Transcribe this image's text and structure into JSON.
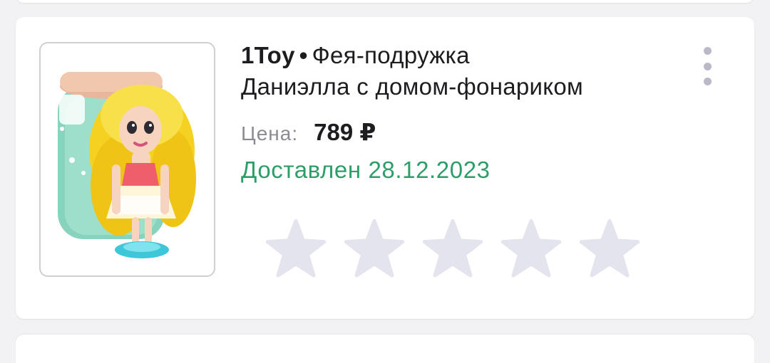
{
  "order": {
    "brand": "1Toy",
    "separator": "•",
    "product_line1": "Фея-подружка",
    "product_line2": "Даниэлла с домом-фонариком",
    "price_label": "Цена:",
    "price_value": "789 ₽",
    "status": "Доставлен 28.12.2023",
    "rating": {
      "max_stars": 5,
      "selected_stars": 0
    },
    "product_image": "doll-with-lantern-house-image"
  },
  "colors": {
    "status_delivered": "#2d9e68",
    "star_empty": "#e4e4ee",
    "more_dots": "#b9b9c8",
    "price_label": "#8b8b94",
    "title": "#1d1d21"
  },
  "icons": {
    "more": "more-vertical-icon",
    "star": "star-icon"
  }
}
